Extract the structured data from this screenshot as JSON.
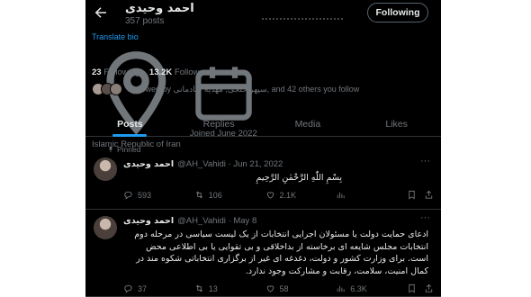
{
  "header": {
    "name": "احمد وحیدی",
    "posts": "357 posts",
    "follow_label": "Following"
  },
  "profile": {
    "translate": "Translate bio",
    "location": "Islamic Republic of Iran",
    "joined": "Joined June 2022",
    "following_count": "23",
    "following_label": "Following",
    "followers_count": "13.2K",
    "followers_label": "Followers",
    "followed_by": "Followed by سپهر خلجی, مهدیه شادمانی, and 42 others you follow"
  },
  "tabs": [
    "Posts",
    "Replies",
    "Media",
    "Likes"
  ],
  "tweets": [
    {
      "pinned": "Pinned",
      "name": "احمد وحیدی",
      "handle_date": "@AH_Vahidi · Jun 21, 2022",
      "text": "بِسْمِ اللّٰهِ الرَّحْمٰنِ الرَّحِیمِ",
      "replies": "593",
      "reposts": "106",
      "likes": "2.1K",
      "views": ""
    },
    {
      "name": "احمد وحیدی",
      "handle_date": "@AH_Vahidi · May 8",
      "text": "ادعای حمایت دولت یا مسئولان اجرایی انتخابات از یک لیست سیاسی در مرحله دوم انتخابات مجلس شایعه ای برخاسته از بداخلاقی و بی تقوایی یا بی اطلاعی محض است. برای وزارت کشور و دولت، دغدغه ای غیر از برگزاری انتخاباتی شکوه مند در کمال امنیت، سلامت، رقابت و مشارکت وجود ندارد.",
      "replies": "37",
      "reposts": "13",
      "likes": "58",
      "views": "6.3K"
    }
  ],
  "colors": {
    "accent": "#1d9bf0",
    "background": "#000000",
    "text": "#e7e9ea",
    "muted": "#71767b"
  }
}
